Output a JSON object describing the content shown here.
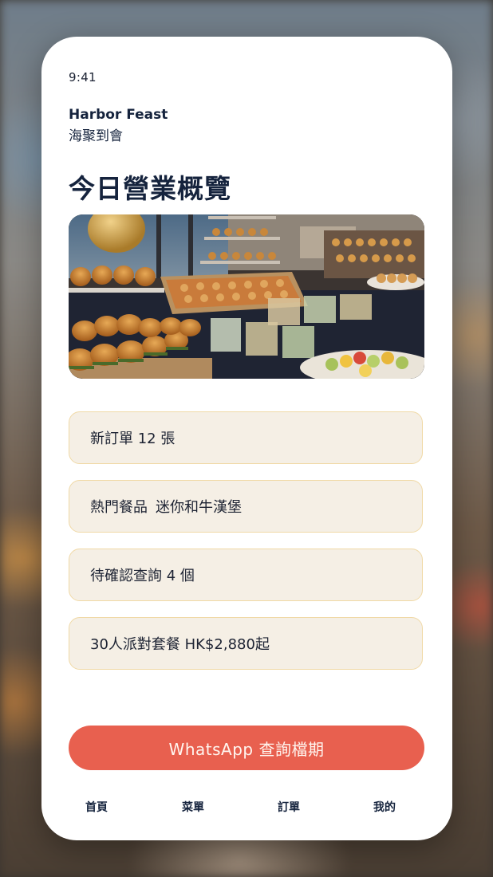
{
  "status_bar": {
    "time": "9:41"
  },
  "brand": {
    "name_en": "Harbor Feast",
    "name_zh": "海聚到會"
  },
  "page": {
    "title": "今日營業概覽"
  },
  "hero_image": {
    "alt": "catering buffet photo",
    "icon": "buffet-photo"
  },
  "summary_cards": [
    {
      "text": "新訂單 12 張"
    },
    {
      "label": "熱門餐品",
      "value": "迷你和牛漢堡"
    },
    {
      "text": "待確認查詢 4 個"
    },
    {
      "text": "30人派對套餐 HK$2,880起"
    }
  ],
  "cta": {
    "label": "WhatsApp 查詢檔期"
  },
  "bottom_nav": [
    {
      "label": "首頁"
    },
    {
      "label": "菜單"
    },
    {
      "label": "訂單"
    },
    {
      "label": "我的"
    }
  ],
  "colors": {
    "primary_text": "#15233d",
    "card_bg": "#f5efe5",
    "card_border": "#f0d9a6",
    "cta_bg": "#e8604f"
  }
}
